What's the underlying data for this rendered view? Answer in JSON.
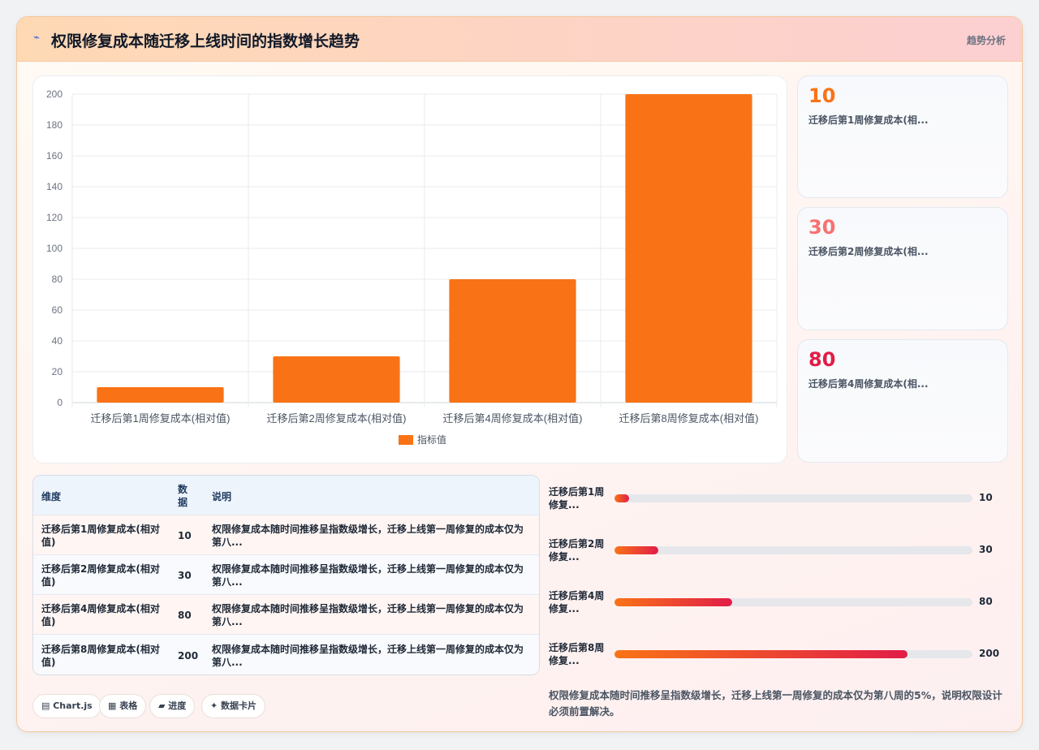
{
  "header": {
    "icon": "chart-trend-icon",
    "title": "权限修复成本随迁移上线时间的指数增长趋势",
    "badge": "趋势分析"
  },
  "chart_data": {
    "type": "bar",
    "categories": [
      "迁移后第1周修复成本(相对值)",
      "迁移后第2周修复成本(相对值)",
      "迁移后第4周修复成本(相对值)",
      "迁移后第8周修复成本(相对值)"
    ],
    "series": [
      {
        "name": "指标值",
        "values": [
          10,
          30,
          80,
          200
        ],
        "color": "#f97316"
      }
    ],
    "yticks": [
      0,
      20,
      40,
      60,
      80,
      100,
      120,
      140,
      160,
      180,
      200
    ],
    "ylim": [
      0,
      200
    ],
    "grid": true,
    "legend": "bottom"
  },
  "stats": [
    {
      "value": "10",
      "label": "迁移后第1周修复成本(相...",
      "color": "#f97316"
    },
    {
      "value": "30",
      "label": "迁移后第2周修复成本(相...",
      "color": "#f87171"
    },
    {
      "value": "80",
      "label": "迁移后第4周修复成本(相...",
      "color": "#e11d48"
    }
  ],
  "table": {
    "headers": [
      "维度",
      "数据",
      "说明"
    ],
    "rows": [
      {
        "dim": "迁移后第1周修复成本(相对值)",
        "value": "10",
        "desc": "权限修复成本随时间推移呈指数级增长，迁移上线第一周修复的成本仅为第八..."
      },
      {
        "dim": "迁移后第2周修复成本(相对值)",
        "value": "30",
        "desc": "权限修复成本随时间推移呈指数级增长，迁移上线第一周修复的成本仅为第八..."
      },
      {
        "dim": "迁移后第4周修复成本(相对值)",
        "value": "80",
        "desc": "权限修复成本随时间推移呈指数级增长，迁移上线第一周修复的成本仅为第八..."
      },
      {
        "dim": "迁移后第8周修复成本(相对值)",
        "value": "200",
        "desc": "权限修复成本随时间推移呈指数级增长，迁移上线第一周修复的成本仅为第八..."
      }
    ]
  },
  "progress": {
    "max": 244,
    "items": [
      {
        "label": "迁移后第1周修复...",
        "value": 10,
        "display": "10"
      },
      {
        "label": "迁移后第2周修复...",
        "value": 30,
        "display": "30"
      },
      {
        "label": "迁移后第4周修复...",
        "value": 80,
        "display": "80"
      },
      {
        "label": "迁移后第8周修复...",
        "value": 200,
        "display": "200"
      }
    ]
  },
  "pills": [
    {
      "icon": "chart-icon",
      "text": "▤ Chart.js"
    },
    {
      "icon": "table-icon",
      "text": "▦ 表格"
    },
    {
      "icon": "progress-icon",
      "text": "▰ 进度"
    },
    {
      "icon": "sparkle-icon",
      "text": "✦ 数据卡片"
    }
  ],
  "note": "权限修复成本随时间推移呈指数级增长，迁移上线第一周修复的成本仅为第八周的5%，说明权限设计必须前置解决。"
}
